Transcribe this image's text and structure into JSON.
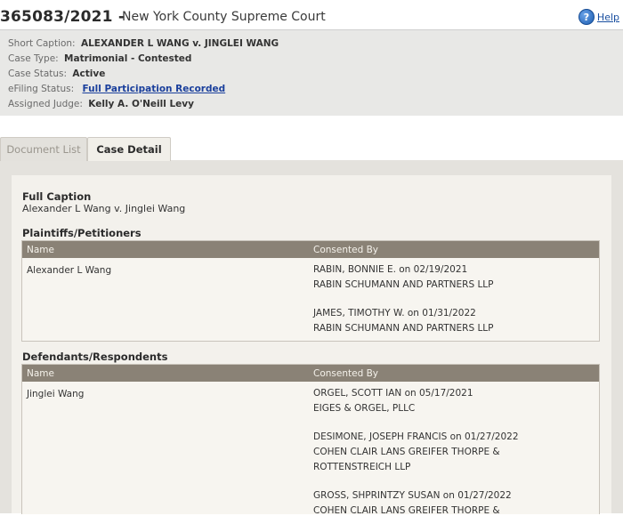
{
  "header": {
    "case_number": "365083/2021 -",
    "court": "New York County Supreme Court",
    "help_label": "Help"
  },
  "summary": {
    "short_caption_label": "Short Caption:",
    "short_caption_value": "ALEXANDER L WANG v. JINGLEI WANG",
    "case_type_label": "Case Type:",
    "case_type_value": "Matrimonial - Contested",
    "case_status_label": "Case Status:",
    "case_status_value": "Active",
    "efiling_label": "eFiling Status:",
    "efiling_value": "Full Participation Recorded",
    "judge_label": "Assigned Judge:",
    "judge_value": "Kelly A. O'Neill Levy"
  },
  "tabs": [
    {
      "label": "Document List",
      "active": false
    },
    {
      "label": "Case Detail",
      "active": true
    }
  ],
  "detail": {
    "full_caption_heading": "Full Caption",
    "full_caption_text": "Alexander L Wang v. Jinglei Wang",
    "plaintiffs_heading": "Plaintiffs/Petitioners",
    "defendants_heading": "Defendants/Respondents",
    "col_name": "Name",
    "col_consented": "Consented By",
    "plaintiffs": {
      "name": "Alexander L Wang",
      "consents": [
        {
          "line1": "RABIN, BONNIE E. on 02/19/2021",
          "line2": "RABIN SCHUMANN AND PARTNERS LLP"
        },
        {
          "line1": "JAMES, TIMOTHY W. on 01/31/2022",
          "line2": "RABIN SCHUMANN AND PARTNERS LLP"
        }
      ]
    },
    "defendants": {
      "name": "Jinglei Wang",
      "consents": [
        {
          "line1": "ORGEL, SCOTT IAN on 05/17/2021",
          "line2": "EIGES & ORGEL, PLLC"
        },
        {
          "line1": "DESIMONE, JOSEPH FRANCIS on 01/27/2022",
          "line2": "COHEN CLAIR LANS GREIFER THORPE &",
          "line3": "ROTTENSTREICH LLP"
        },
        {
          "line1": "GROSS, SHPRINTZY SUSAN on 01/27/2022",
          "line2": "COHEN CLAIR LANS GREIFER THORPE &"
        }
      ]
    }
  },
  "icons": {
    "help": "help-icon"
  },
  "colors": {
    "link": "#1a3f9c",
    "table_header": "#8a8276",
    "summary_bg": "#e8e8e6"
  }
}
